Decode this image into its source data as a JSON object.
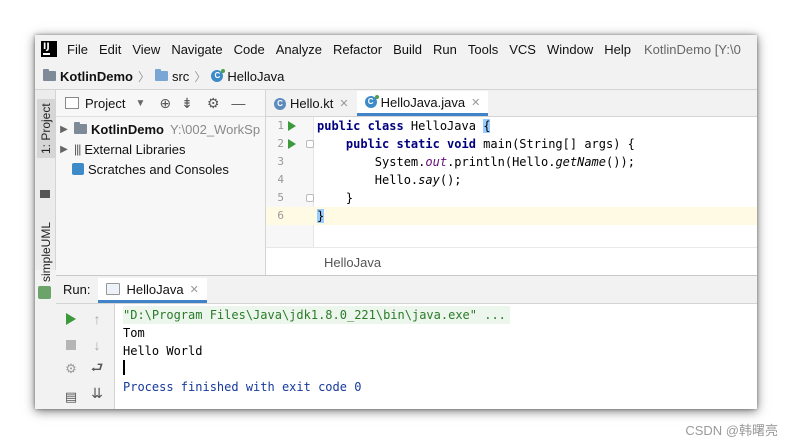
{
  "menu": {
    "items": [
      "File",
      "Edit",
      "View",
      "Navigate",
      "Code",
      "Analyze",
      "Refactor",
      "Build",
      "Run",
      "Tools",
      "VCS",
      "Window",
      "Help"
    ],
    "title": "KotlinDemo [Y:\\0"
  },
  "breadcrumb": {
    "project": "KotlinDemo",
    "folder": "src",
    "file": "HelloJava"
  },
  "left_strip": {
    "project_tab": "1: Project",
    "uml_tab": "simpleUML"
  },
  "project_panel": {
    "title": "Project",
    "tree": [
      {
        "label": "KotlinDemo",
        "path": "Y:\\002_WorkSp"
      },
      {
        "label": "External Libraries"
      },
      {
        "label": "Scratches and Consoles"
      }
    ]
  },
  "editor": {
    "tabs": [
      {
        "label": "Hello.kt",
        "active": false
      },
      {
        "label": "HelloJava.java",
        "active": true
      }
    ],
    "line_numbers": [
      "1",
      "2",
      "3",
      "4",
      "5",
      "6"
    ],
    "code": {
      "l1_kw": "public class",
      "l1_name": " HelloJava ",
      "l1_brace": "{",
      "l2_indent": "    ",
      "l2_kw": "public static void",
      "l2_rest": " main(String[] args) {",
      "l3_pre": "        System.",
      "l3_field": "out",
      "l3_post": ".println(Hello.",
      "l3_it": "getName",
      "l3_end": "());",
      "l4_pre": "        Hello.",
      "l4_it": "say",
      "l4_end": "();",
      "l5": "    }",
      "l6": "}"
    },
    "footer": "HelloJava"
  },
  "run_panel": {
    "label": "Run:",
    "tab": "HelloJava",
    "console": {
      "cmd": "\"D:\\Program Files\\Java\\jdk1.8.0_221\\bin\\java.exe\" ...",
      "out1": "Tom",
      "out2": "Hello World",
      "done": "Process finished with exit code 0"
    }
  },
  "watermark": "CSDN @韩曙亮",
  "colors": {
    "accent": "#4083c9",
    "run_green": "#3c9a3c",
    "keyword": "#000080",
    "console_finish": "#16399c"
  }
}
